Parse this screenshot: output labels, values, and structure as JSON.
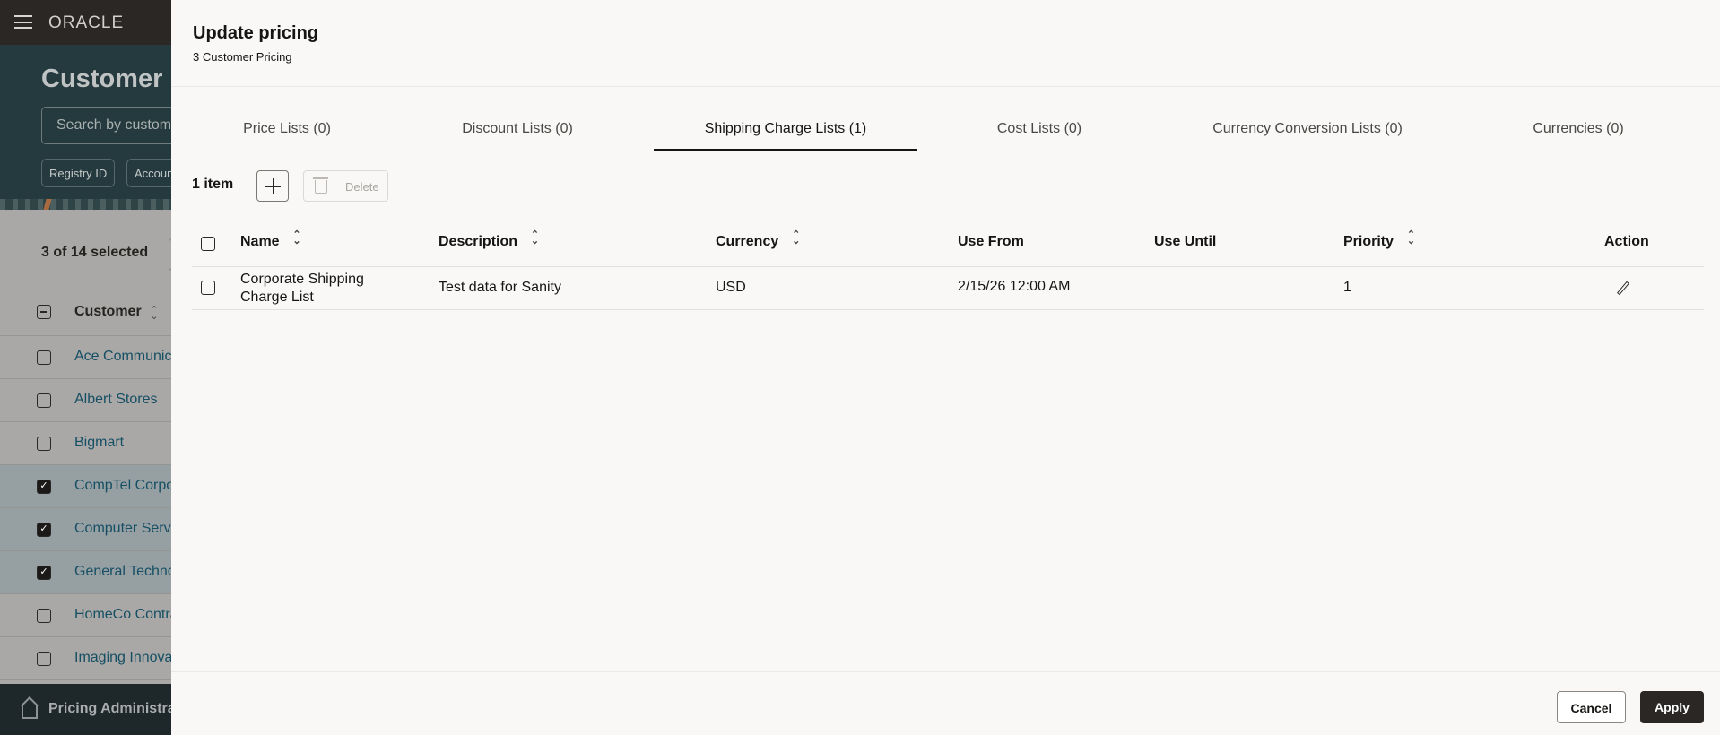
{
  "app": {
    "brand": "ORACLE",
    "page_title": "Customer Pricing",
    "search_placeholder": "Search by customer",
    "chips": [
      "Registry ID",
      "Account"
    ],
    "selection": "3 of 14 selected",
    "column_header": "Customer",
    "customers": [
      {
        "name": "Ace Communications",
        "checked": false
      },
      {
        "name": "Albert Stores",
        "checked": false
      },
      {
        "name": "Bigmart",
        "checked": false
      },
      {
        "name": "CompTel Corporation",
        "checked": true
      },
      {
        "name": "Computer Service",
        "checked": true
      },
      {
        "name": "General Technology",
        "checked": true
      },
      {
        "name": "HomeCo Contractors",
        "checked": false
      },
      {
        "name": "Imaging Innovations",
        "checked": false
      }
    ],
    "footer_label": "Pricing Administration"
  },
  "drawer": {
    "title": "Update pricing",
    "subtitle": "3 Customer Pricing",
    "tabs": [
      {
        "label": "Price Lists (0)",
        "active": false
      },
      {
        "label": "Discount Lists (0)",
        "active": false
      },
      {
        "label": "Shipping Charge Lists (1)",
        "active": true
      },
      {
        "label": "Cost Lists (0)",
        "active": false
      },
      {
        "label": "Currency Conversion Lists (0)",
        "active": false
      },
      {
        "label": "Currencies (0)",
        "active": false
      }
    ],
    "item_count": "1 item",
    "delete_label": "Delete",
    "columns": [
      "Name",
      "Description",
      "Currency",
      "Use From",
      "Use Until",
      "Priority",
      "Action"
    ],
    "rows": [
      {
        "name_line1": "Corporate Shipping",
        "name_line2": "Charge List",
        "description": "Test data for Sanity",
        "currency": "USD",
        "use_from": "2/15/26 12:00 AM",
        "use_until": "",
        "priority": "1"
      }
    ],
    "cancel_label": "Cancel",
    "apply_label": "Apply"
  }
}
